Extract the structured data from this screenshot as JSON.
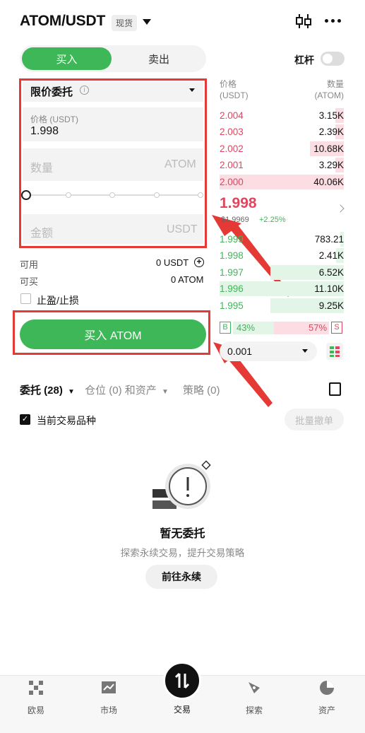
{
  "header": {
    "pair": "ATOM/USDT",
    "market_badge": "现货"
  },
  "side_tabs": {
    "buy": "买入",
    "sell": "卖出"
  },
  "leverage": {
    "label": "杠杆"
  },
  "form": {
    "order_type": "限价委托",
    "price_label": "价格 (USDT)",
    "price_value": "1.998",
    "qty_placeholder": "数量",
    "qty_unit": "ATOM",
    "amount_placeholder": "金额",
    "amount_unit": "USDT",
    "available_label": "可用",
    "available_value": "0 USDT",
    "can_buy_label": "可买",
    "can_buy_value": "0 ATOM",
    "tpsl_label": "止盈/止损",
    "buy_button": "买入 ATOM"
  },
  "orderbook": {
    "price_head": "价格",
    "price_unit": "(USDT)",
    "qty_head": "数量",
    "qty_unit": "(ATOM)",
    "asks": [
      {
        "price": "2.004",
        "qty": "3.15K",
        "depth": 0.07
      },
      {
        "price": "2.003",
        "qty": "2.39K",
        "depth": 0.07
      },
      {
        "price": "2.002",
        "qty": "10.68K",
        "depth": 0.27
      },
      {
        "price": "2.001",
        "qty": "3.29K",
        "depth": 0.07
      },
      {
        "price": "2.000",
        "qty": "40.06K",
        "depth": 1.0
      }
    ],
    "last_price": "1.998",
    "last_usd": "$1.9969",
    "last_change": "+2.25%",
    "bids": [
      {
        "price": "1.999",
        "qty": "783.21",
        "depth": 0.03
      },
      {
        "price": "1.998",
        "qty": "2.41K",
        "depth": 0.06
      },
      {
        "price": "1.997",
        "qty": "6.52K",
        "depth": 0.59
      },
      {
        "price": "1.996",
        "qty": "11.10K",
        "depth": 1.0
      },
      {
        "price": "1.995",
        "qty": "9.25K",
        "depth": 0.59
      }
    ],
    "buy_ratio_label": "B",
    "buy_ratio": "43%",
    "sell_ratio": "57%",
    "sell_ratio_label": "S",
    "precision": "0.001"
  },
  "tabs": {
    "orders": "委托 (28)",
    "positions": "仓位 (0) 和资产",
    "strategy": "策略 (0)"
  },
  "filter": {
    "current_pair": "当前交易品种",
    "batch_cancel": "批量撤单"
  },
  "empty": {
    "title": "暂无委托",
    "subtitle": "探索永续交易，提升交易策略",
    "button": "前往永续"
  },
  "nav": [
    {
      "label": "欧易"
    },
    {
      "label": "市场"
    },
    {
      "label": "交易"
    },
    {
      "label": "探索"
    },
    {
      "label": "资产"
    }
  ],
  "colors": {
    "buy": "#3db757",
    "sell": "#e0465f",
    "highlight": "#e53935"
  }
}
